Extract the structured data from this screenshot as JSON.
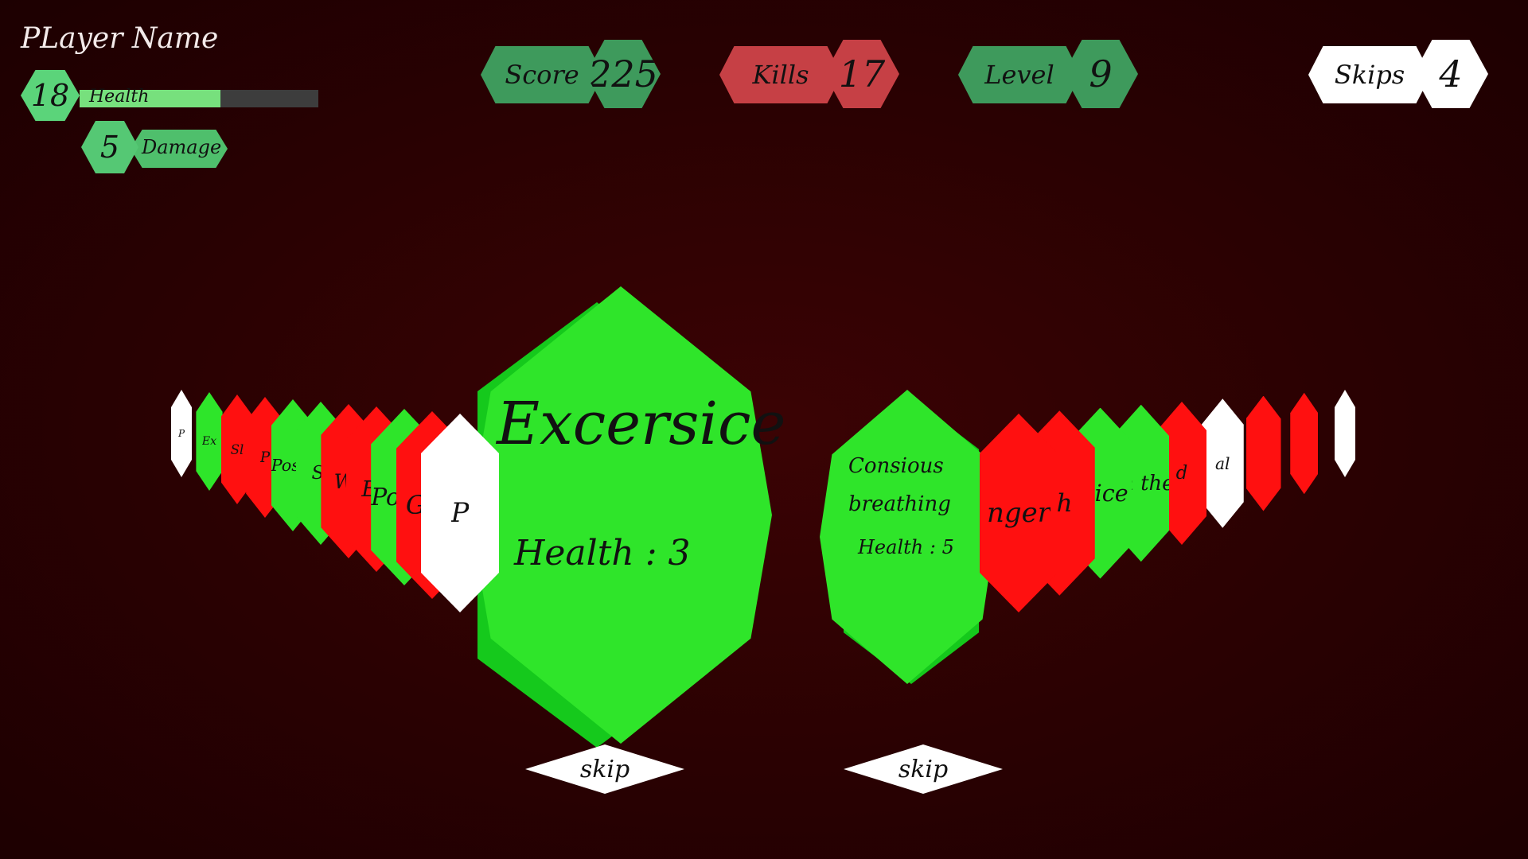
{
  "player": {
    "name": "PLayer Name",
    "health_value": "18",
    "health_label": "Health",
    "health_fraction": 0.59,
    "damage_value": "5",
    "damage_label": "Damage"
  },
  "stats": {
    "score": {
      "label": "Score",
      "value": "225"
    },
    "kills": {
      "label": "Kills",
      "value": "17"
    },
    "level": {
      "label": "Level",
      "value": "9"
    },
    "skips": {
      "label": "Skips",
      "value": "4"
    }
  },
  "left_fan": [
    {
      "text": "P",
      "color": "#ffffff"
    },
    {
      "text": "Ex",
      "color": "#2ee52a"
    },
    {
      "text": "Sl",
      "color": "#ff1010"
    },
    {
      "text": "P",
      "color": "#ff1010"
    },
    {
      "text": "Positi",
      "color": "#2ee52a"
    },
    {
      "text": "Sl",
      "color": "#2ee52a"
    },
    {
      "text": "Wr",
      "color": "#ff1010"
    },
    {
      "text": "Eg",
      "color": "#ff1010"
    },
    {
      "text": "Positive Though",
      "color": "#2ee52a"
    },
    {
      "text": "Guil",
      "color": "#ff1010"
    },
    {
      "text": "P",
      "color": "#ffffff"
    }
  ],
  "right_fan": [
    {
      "text": "nger",
      "color": "#ff1010"
    },
    {
      "text": "th",
      "color": "#ff1010"
    },
    {
      "text": "rsice",
      "color": "#2ee52a"
    },
    {
      "text": "In the",
      "color": "#2ee52a"
    },
    {
      "text": "d",
      "color": "#ff1010"
    },
    {
      "text": "al",
      "color": "#ffffff"
    },
    {
      "text": "",
      "color": "#ff1010"
    },
    {
      "text": "",
      "color": "#ff1010"
    },
    {
      "text": "",
      "color": "#ffffff"
    }
  ],
  "selected_card": {
    "title": "Excersice",
    "stat": "Health : 3"
  },
  "second_card": {
    "title": "Consious\nbreathing",
    "stat": "Health : 5"
  },
  "skip_buttons": {
    "left_label": "skip",
    "right_label": "skip"
  },
  "colors": {
    "background": "#2a0102",
    "green": "#2fe52a",
    "red": "#ff1010",
    "stat_green": "#3e9a5c",
    "stat_red": "#c64045"
  }
}
